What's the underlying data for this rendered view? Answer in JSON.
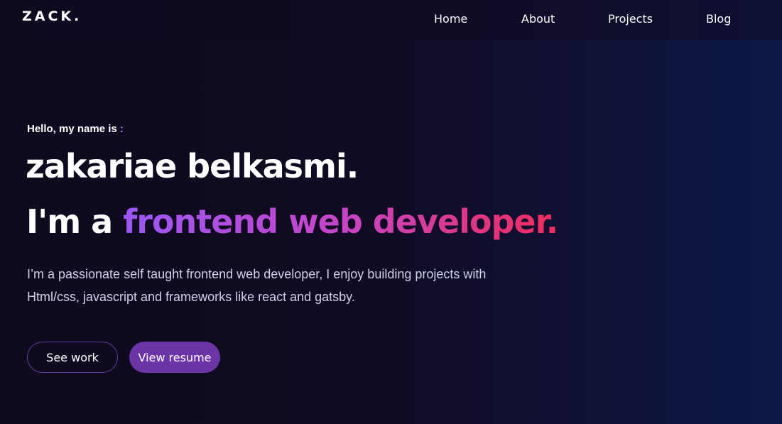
{
  "nav": {
    "logo": "ZACK.",
    "items": [
      {
        "label": "Home"
      },
      {
        "label": "About"
      },
      {
        "label": "Projects"
      },
      {
        "label": "Blog"
      }
    ]
  },
  "hero": {
    "greeting": "Hello, my name is",
    "greeting_colon": ":",
    "name": "zakariae belkasmi.",
    "role_prefix": "I'm a",
    "role_highlight": "frontend web developer.",
    "description": "I’m a passionate self taught frontend web developer, I enjoy building projects with Html/css, javascript and frameworks like react and gatsby.",
    "buttons": {
      "see_work": "See work",
      "view_resume": "View resume"
    }
  },
  "colors": {
    "background": "#0f0a1e",
    "accent_purple": "#6b35a8",
    "gradient_start": "#9b57f5",
    "gradient_end": "#f02c5a"
  }
}
